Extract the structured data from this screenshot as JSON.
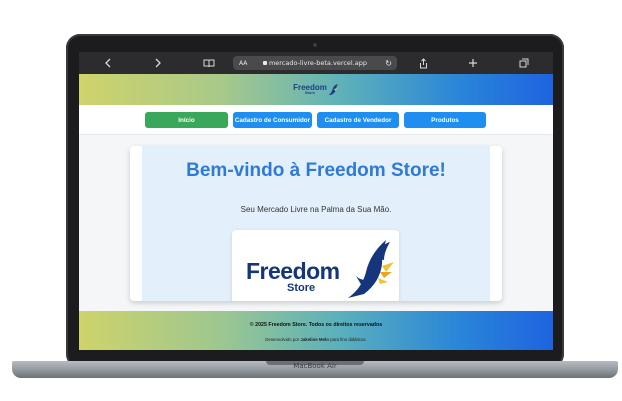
{
  "device": {
    "label": "MacBook Air"
  },
  "browser": {
    "url": "mercado-livre-beta.vercel.app",
    "reader_label": "AA",
    "icons": [
      "back-icon",
      "forward-icon",
      "book-icon",
      "lock-icon",
      "reload-icon",
      "share-icon",
      "plus-icon",
      "tabs-icon"
    ]
  },
  "site": {
    "logo_small": {
      "word": "Freedom",
      "sub": "Store"
    },
    "nav": {
      "items": [
        {
          "label": "Início",
          "active": true
        },
        {
          "label": "Cadastro de Consumidor",
          "active": false
        },
        {
          "label": "Cadastro de Vendedor",
          "active": false
        },
        {
          "label": "Produtos",
          "active": false
        }
      ]
    },
    "hero": {
      "title": "Bem-vindo à Freedom Store!",
      "tagline": "Seu Mercado Livre na Palma da Sua Mão.",
      "logo_word": "Freedom",
      "logo_sub": "Store"
    },
    "footer": {
      "copyright": "© 2025 Freedom Store. Todos os direitos reservados",
      "dev_prefix": "Desenvolvido por",
      "dev_name": "Jakeline Melo",
      "dev_suffix": "para fins didáticos."
    },
    "colors": {
      "brand_navy": "#15357c",
      "accent_blue": "#1e8ef0",
      "active_green": "#3aa85a",
      "title_blue": "#2f7ad8"
    }
  }
}
